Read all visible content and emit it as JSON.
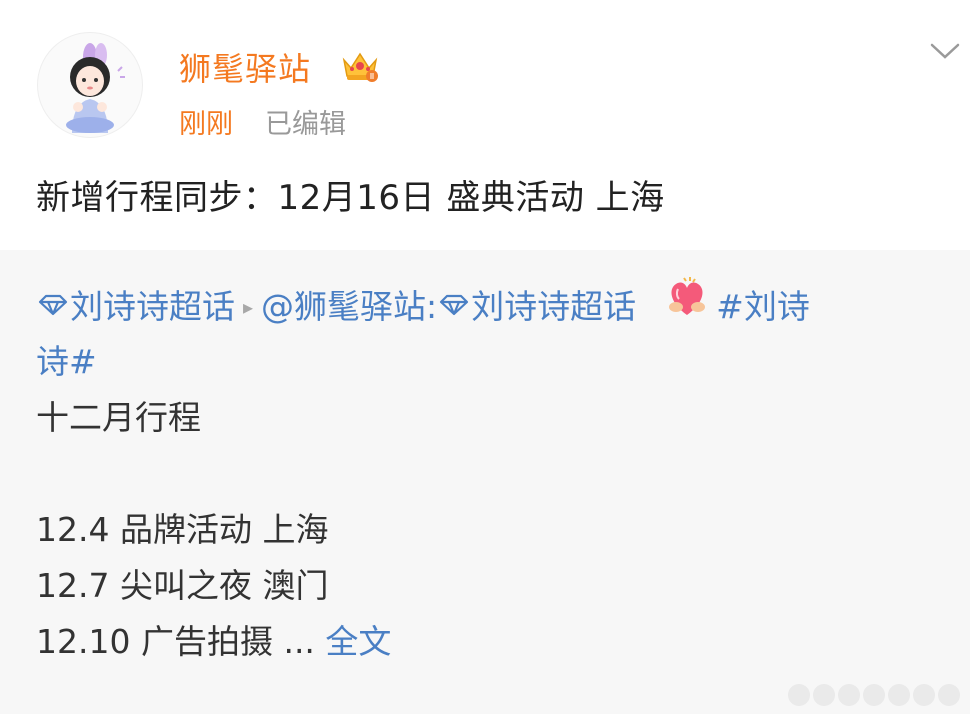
{
  "post": {
    "author": {
      "name": "狮髦驿站",
      "avatar_icon": "cartoon-girl-avatar",
      "badge_icon": "vip-crown-icon"
    },
    "time": "刚刚",
    "edited_label": "已编辑",
    "text": "新增行程同步：12月16日 盛典活动 上海",
    "menu_icon": "chevron-down-icon"
  },
  "repost": {
    "supertopic_1": "刘诗诗超话",
    "mention": "@狮髦驿站:",
    "supertopic_2": "刘诗诗超话",
    "hashtag_part1": "#刘诗",
    "hashtag_part2": "诗#",
    "heading": "十二月行程",
    "schedule": [
      "12.4 品牌活动 上海",
      "12.7 尖叫之夜 澳门",
      "12.10 广告拍摄 ..."
    ],
    "full_text_link": "全文",
    "emoji_icon": "heart-hug-emoji-icon",
    "supertopic_icon": "diamond-icon"
  },
  "colors": {
    "accent_orange": "#f47920",
    "link_blue": "#4a7fc4",
    "repost_bg": "#f7f7f7",
    "meta_gray": "#999999"
  }
}
